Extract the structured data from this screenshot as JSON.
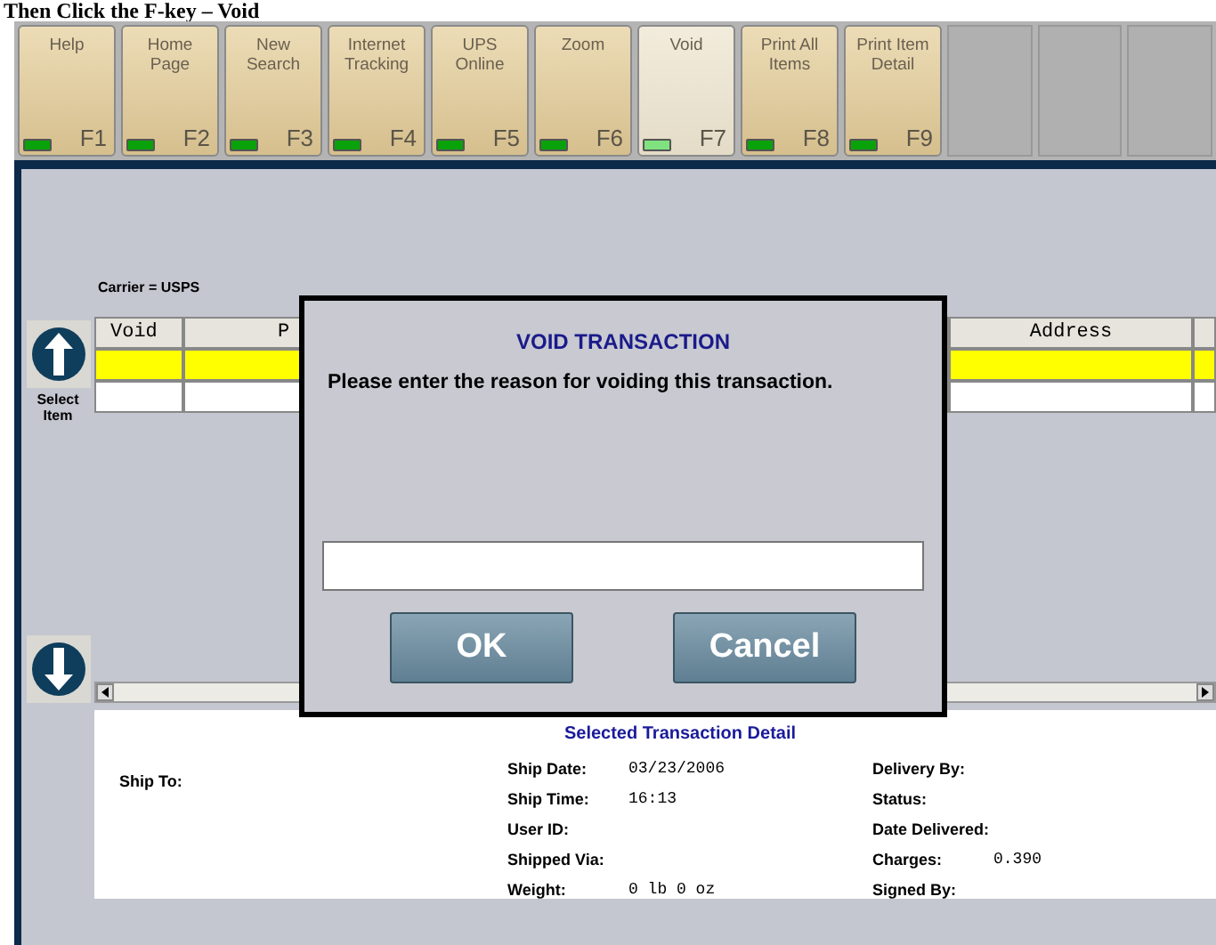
{
  "heading": "Then Click the F-key – Void",
  "function_keys": [
    {
      "label": "Help",
      "key": "F1",
      "selected": false
    },
    {
      "label": "Home Page",
      "key": "F2",
      "selected": false
    },
    {
      "label": "New Search",
      "key": "F3",
      "selected": false
    },
    {
      "label": "Internet Tracking",
      "key": "F4",
      "selected": false
    },
    {
      "label": "UPS Online",
      "key": "F5",
      "selected": false
    },
    {
      "label": "Zoom",
      "key": "F6",
      "selected": false
    },
    {
      "label": "Void",
      "key": "F7",
      "selected": true
    },
    {
      "label": "Print All Items",
      "key": "F8",
      "selected": false
    },
    {
      "label": "Print Item Detail",
      "key": "F9",
      "selected": false
    }
  ],
  "filter": "Carrier = USPS",
  "select_item": "Select Item",
  "table": {
    "columns": [
      "Void",
      "P",
      "Address"
    ],
    "rows": [
      {
        "selected": true
      },
      {
        "selected": false
      }
    ]
  },
  "detail": {
    "title": "Selected Transaction Detail",
    "ship_to": "Ship To:",
    "middle": [
      {
        "label": "Ship Date:",
        "value": "03/23/2006"
      },
      {
        "label": "Ship Time:",
        "value": "16:13"
      },
      {
        "label": "User ID:"
      },
      {
        "label": "Shipped Via:"
      },
      {
        "label": "Weight:",
        "value": "0 lb 0 oz"
      }
    ],
    "right": [
      {
        "label": "Delivery By:"
      },
      {
        "label": "Status:"
      },
      {
        "label": "Date Delivered:"
      },
      {
        "label": "Charges:",
        "value": "0.390"
      },
      {
        "label": "Signed By:"
      }
    ]
  },
  "dialog": {
    "title": "VOID TRANSACTION",
    "message": "Please enter the reason for voiding this transaction.",
    "buttons": [
      "OK",
      "Cancel"
    ]
  }
}
